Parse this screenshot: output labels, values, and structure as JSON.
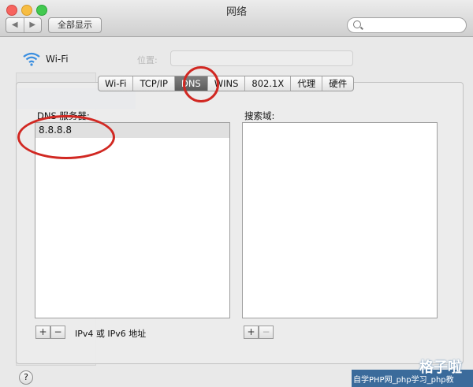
{
  "window": {
    "title": "网络"
  },
  "toolbar": {
    "back": "◀",
    "forward": "▶",
    "show_all": "全部显示",
    "search_placeholder": ""
  },
  "background": {
    "service": "Wi-Fi",
    "location_label": "位置:"
  },
  "tabs": [
    "Wi-Fi",
    "TCP/IP",
    "DNS",
    "WINS",
    "802.1X",
    "代理",
    "硬件"
  ],
  "active_tab": "DNS",
  "dns": {
    "servers_label": "DNS 服务器:",
    "servers": [
      "8.8.8.8"
    ],
    "add": "+",
    "remove": "−",
    "hint": "IPv4 或 IPv6 地址"
  },
  "search_domains": {
    "label": "搜索域:",
    "domains": [],
    "add": "+",
    "remove": "−"
  },
  "help": "?",
  "watermark": {
    "main": "格子啦",
    "site": "自学PHP网_php学习_php教"
  },
  "annotation_color": "#d12822"
}
